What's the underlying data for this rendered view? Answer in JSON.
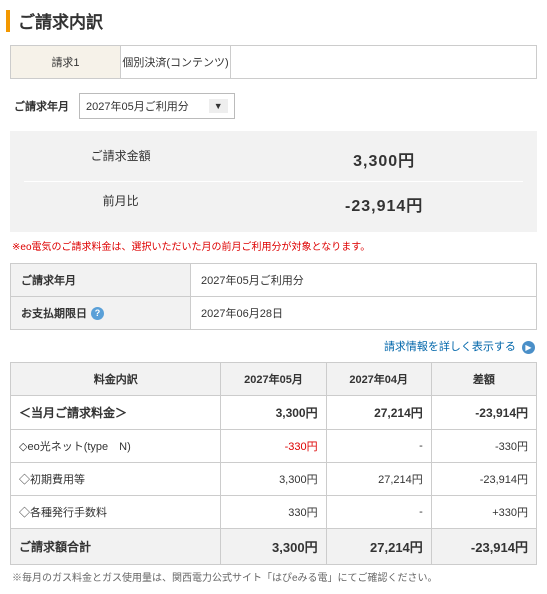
{
  "title": "ご請求内訳",
  "tabs": {
    "active": "請求1",
    "inactive": "個別決済(コンテンツ)"
  },
  "period": {
    "label": "ご請求年月",
    "selected": "2027年05月ご利用分"
  },
  "summary": {
    "amount_label": "ご請求金額",
    "amount_value": "3,300円",
    "diff_label": "前月比",
    "diff_value": "-23,914円"
  },
  "red_note": "※eo電気のご請求料金は、選択いただいた月の前月ご利用分が対象となります。",
  "info": {
    "period_label": "ご請求年月",
    "period_value": "2027年05月ご利用分",
    "due_label": "お支払期限日",
    "due_value": "2027年06月28日"
  },
  "detail_link": "請求情報を詳しく表示する",
  "breakdown": {
    "headers": {
      "item": "料金内訳",
      "cur": "2027年05月",
      "prev": "2027年04月",
      "diff": "差額"
    },
    "rows": [
      {
        "label": "＜当月ご請求料金＞",
        "cur": "3,300円",
        "prev": "27,214円",
        "diff": "-23,914円",
        "bold": true
      },
      {
        "label": "◇eo光ネット(type　N)",
        "cur": "-330円",
        "cur_neg": true,
        "prev": "-",
        "diff": "-330円"
      },
      {
        "label": "◇初期費用等",
        "cur": "3,300円",
        "prev": "27,214円",
        "diff": "-23,914円"
      },
      {
        "label": "◇各種発行手数料",
        "cur": "330円",
        "prev": "-",
        "diff": "+330円"
      }
    ],
    "total": {
      "label": "ご請求額合計",
      "cur": "3,300円",
      "prev": "27,214円",
      "diff": "-23,914円"
    }
  },
  "foot_note": "※毎月のガス料金とガス使用量は、関西電力公式サイト「はぴeみる電」にてご確認ください。"
}
